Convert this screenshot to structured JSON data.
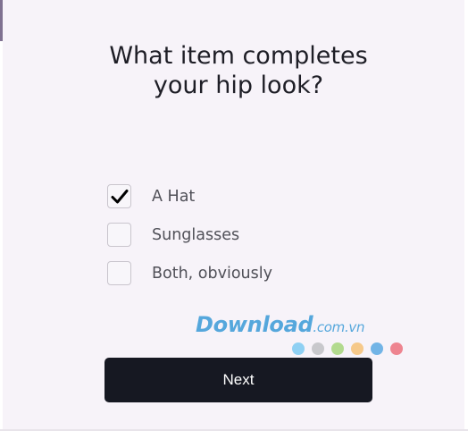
{
  "question": {
    "line1": "What item completes",
    "line2": "your hip look?"
  },
  "options": [
    {
      "label": "A Hat",
      "checked": true
    },
    {
      "label": "Sunglasses",
      "checked": false
    },
    {
      "label": "Both, obviously",
      "checked": false
    }
  ],
  "next_button": {
    "label": "Next"
  },
  "watermark": {
    "brand": "Download",
    "suffix": ".com.vn",
    "dot_colors": [
      "#8fd0f3",
      "#c8c8cc",
      "#b2da8e",
      "#f6c98a",
      "#72b4e6",
      "#ee8490"
    ]
  },
  "colors": {
    "background": "#f7f3f9",
    "button": "#161822",
    "check": "#000000"
  }
}
